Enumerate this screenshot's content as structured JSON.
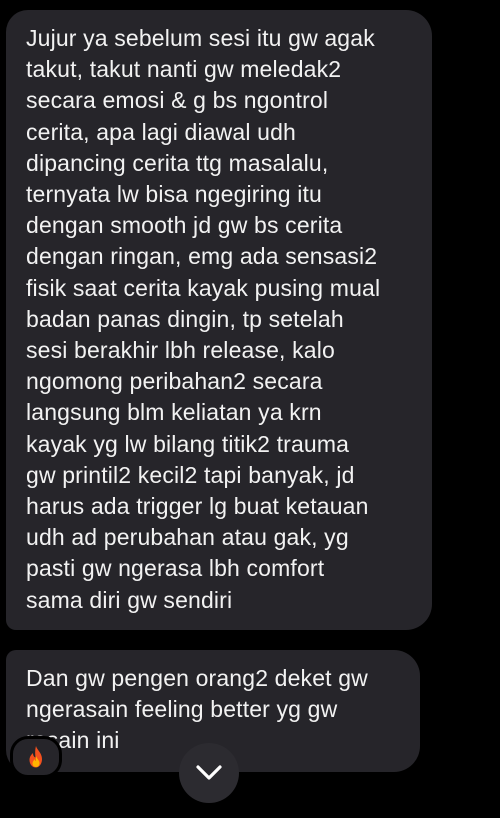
{
  "messages": [
    {
      "text": "Jujur ya sebelum sesi itu gw agak\ntakut, takut nanti gw meledak2\nsecara emosi & g bs ngontrol\ncerita, apa lagi diawal udh\ndipancing cerita ttg masalalu,\nternyata lw bisa ngegiring itu\ndengan smooth jd gw bs cerita\ndengan ringan, emg ada sensasi2\nfisik saat cerita kayak pusing mual\nbadan panas dingin, tp setelah\nsesi berakhir lbh release, kalo\nngomong peribahan2 secara\nlangsung blm keliatan ya krn\nkayak yg lw bilang titik2 trauma\ngw printil2 kecil2 tapi banyak, jd\nharus ada trigger lg buat ketauan\nudh ad perubahan atau gak, yg\npasti gw ngerasa lbh comfort\nsama diri gw sendiri"
    },
    {
      "text": "Dan gw pengen orang2 deket gw\nngerasain feeling better yg gw\nrasain ini"
    }
  ],
  "reaction": {
    "icon": "fire-icon"
  },
  "scroll_button": {
    "icon": "chevron-down-icon"
  },
  "colors": {
    "background": "#000000",
    "bubble": "#26252a",
    "text": "#f2f2f2",
    "fire_outer": "#f4511e",
    "fire_inner": "#ffb300"
  }
}
